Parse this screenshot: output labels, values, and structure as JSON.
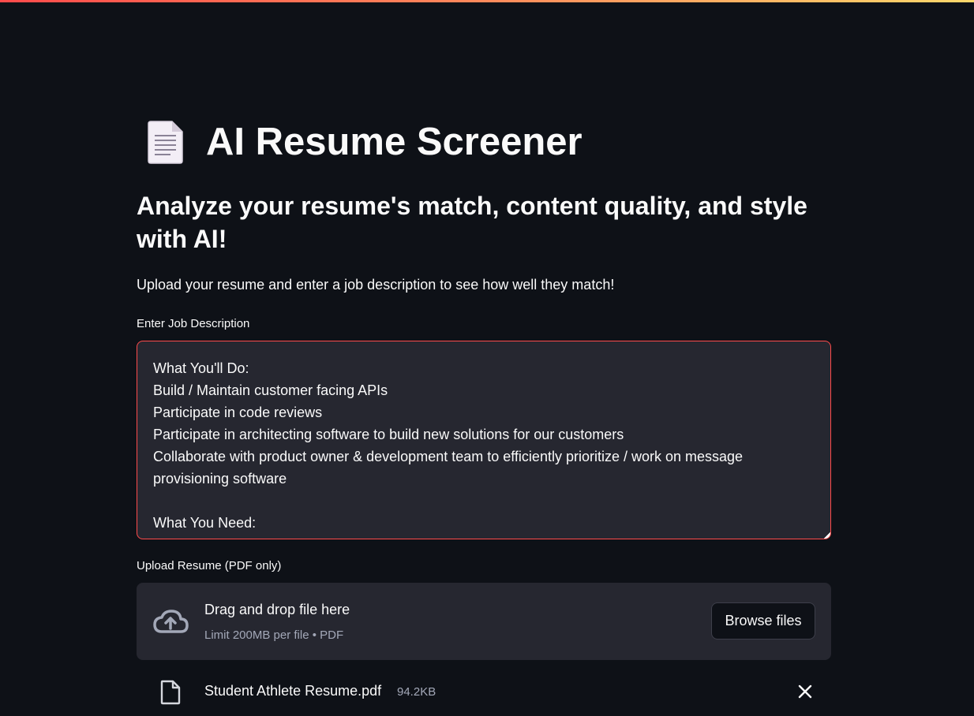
{
  "header": {
    "accent_gradient": [
      "#ff4b4b",
      "#ff8a5b",
      "#fdd86b"
    ]
  },
  "app": {
    "title_icon": "document-icon",
    "title": "AI Resume Screener",
    "subtitle": "Analyze your resume's match, content quality, and style with AI!",
    "intro": "Upload your resume and enter a job description to see how well they match!"
  },
  "job_description": {
    "label": "Enter Job Description",
    "value": "What You'll Do:\nBuild / Maintain customer facing APIs\nParticipate in code reviews\nParticipate in architecting software to build new solutions for our customers\nCollaborate with product owner & development team to efficiently prioritize / work on message provisioning software\n\nWhat You Need:"
  },
  "upload": {
    "label": "Upload Resume (PDF only)",
    "drop_title": "Drag and drop file here",
    "drop_limit": "Limit 200MB per file • PDF",
    "browse_label": "Browse files",
    "icon": "cloud-upload-icon"
  },
  "uploaded_file": {
    "name": "Student Athlete Resume.pdf",
    "size": "94.2KB",
    "icon": "file-icon",
    "remove_icon": "close-icon"
  },
  "colors": {
    "background": "#0e1117",
    "surface": "#262730",
    "focus_border": "#ff4b4b",
    "muted_text": "#a3a8b8"
  }
}
